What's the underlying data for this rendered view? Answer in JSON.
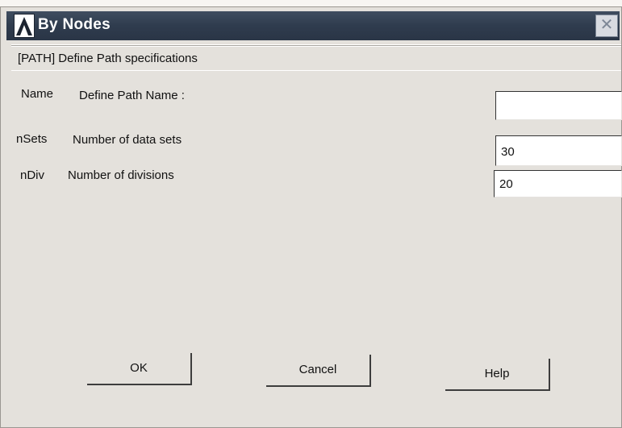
{
  "window": {
    "title": "By Nodes",
    "close_glyph": "✕",
    "logo_icon": "ansys-logo-icon"
  },
  "header": {
    "path_label": "[PATH]  Define Path specifications"
  },
  "rows": [
    {
      "key": "Name",
      "desc": "Define Path Name :",
      "value": ""
    },
    {
      "key": "nSets",
      "desc": "Number of data sets",
      "value": "30"
    },
    {
      "key": "nDiv",
      "desc": "Number of divisions",
      "value": "20"
    }
  ],
  "buttons": {
    "ok": "OK",
    "cancel": "Cancel",
    "help": "Help"
  },
  "colors": {
    "titlebar": "#2f3c4e",
    "title_text": "#ffffff",
    "dialog_bg": "#e1ded8",
    "field_bg": "#ffffff"
  }
}
